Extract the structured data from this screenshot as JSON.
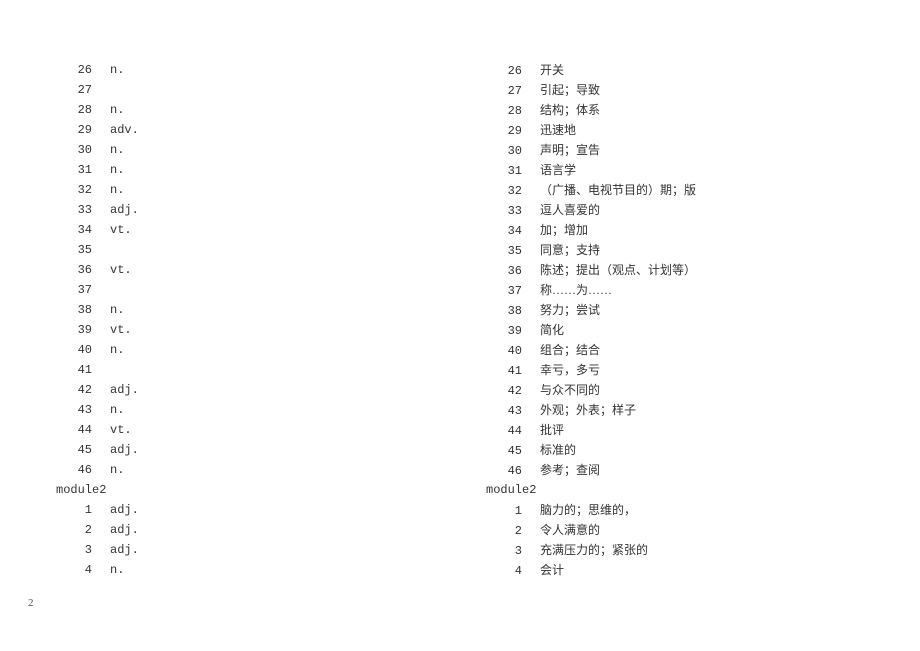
{
  "leftColumn": {
    "rows": [
      {
        "num": "26",
        "text": "n."
      },
      {
        "num": "27",
        "text": ""
      },
      {
        "num": "28",
        "text": "n."
      },
      {
        "num": "29",
        "text": "adv."
      },
      {
        "num": "30",
        "text": "n."
      },
      {
        "num": "31",
        "text": "n."
      },
      {
        "num": "32",
        "text": "n."
      },
      {
        "num": "33",
        "text": "adj."
      },
      {
        "num": "34",
        "text": "vt."
      },
      {
        "num": "35",
        "text": ""
      },
      {
        "num": "36",
        "text": "vt."
      },
      {
        "num": "37",
        "text": ""
      },
      {
        "num": "38",
        "text": "n."
      },
      {
        "num": "39",
        "text": "vt."
      },
      {
        "num": "40",
        "text": "n."
      },
      {
        "num": "41",
        "text": ""
      },
      {
        "num": "42",
        "text": "adj."
      },
      {
        "num": "43",
        "text": "n."
      },
      {
        "num": "44",
        "text": "vt."
      },
      {
        "num": "45",
        "text": "adj."
      },
      {
        "num": "46",
        "text": "n."
      }
    ],
    "module": "module2",
    "moduleRows": [
      {
        "num": "1",
        "text": "adj."
      },
      {
        "num": "2",
        "text": "adj."
      },
      {
        "num": "3",
        "text": "adj."
      },
      {
        "num": "4",
        "text": "n."
      }
    ]
  },
  "rightColumn": {
    "rows": [
      {
        "num": "26",
        "text": "开关"
      },
      {
        "num": "27",
        "text": "引起；导致"
      },
      {
        "num": "28",
        "text": "结构；体系"
      },
      {
        "num": "29",
        "text": "迅速地"
      },
      {
        "num": "30",
        "text": "声明；宣告"
      },
      {
        "num": "31",
        "text": "语言学"
      },
      {
        "num": "32",
        "text": "（广播、电视节目的）期；版"
      },
      {
        "num": "33",
        "text": "逗人喜爱的"
      },
      {
        "num": "34",
        "text": "加；增加"
      },
      {
        "num": "35",
        "text": "同意；支持"
      },
      {
        "num": "36",
        "text": "陈述；提出（观点、计划等）"
      },
      {
        "num": "37",
        "text": "称……为……"
      },
      {
        "num": "38",
        "text": "努力；尝试"
      },
      {
        "num": "39",
        "text": "简化"
      },
      {
        "num": "40",
        "text": "组合；结合"
      },
      {
        "num": "41",
        "text": "幸亏，多亏"
      },
      {
        "num": "42",
        "text": "与众不同的"
      },
      {
        "num": "43",
        "text": "外观；外表；样子"
      },
      {
        "num": "44",
        "text": "批评"
      },
      {
        "num": "45",
        "text": "标准的"
      },
      {
        "num": "46",
        "text": "参考；查阅"
      }
    ],
    "module": "module2",
    "moduleRows": [
      {
        "num": "1",
        "text": "脑力的；思维的，"
      },
      {
        "num": "2",
        "text": "令人满意的"
      },
      {
        "num": "3",
        "text": "充满压力的；紧张的"
      },
      {
        "num": "4",
        "text": "会计"
      }
    ]
  },
  "pageNumber": "2"
}
